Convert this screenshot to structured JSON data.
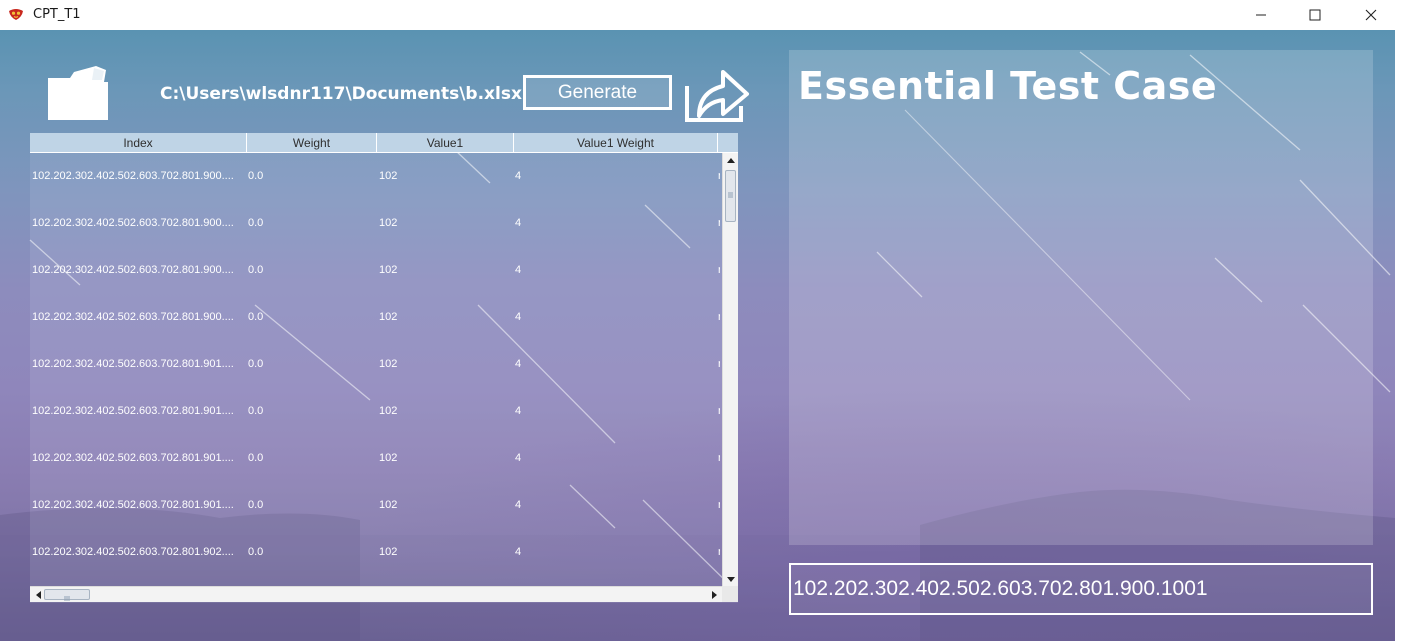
{
  "window": {
    "title": "CPT_T1"
  },
  "toolbar": {
    "file_path": "C:\\Users\\wlsdnr117\\Documents\\b.xlsx",
    "generate_label": "Generate"
  },
  "table": {
    "columns": [
      "Index",
      "Weight",
      "Value1",
      "Value1 Weight"
    ],
    "rows": [
      {
        "index": "102.202.302.402.502.603.702.801.900....",
        "weight": "0.0",
        "value1": "102",
        "value1_weight": "4",
        "overflow": "r"
      },
      {
        "index": "102.202.302.402.502.603.702.801.900....",
        "weight": "0.0",
        "value1": "102",
        "value1_weight": "4",
        "overflow": "r"
      },
      {
        "index": "102.202.302.402.502.603.702.801.900....",
        "weight": "0.0",
        "value1": "102",
        "value1_weight": "4",
        "overflow": "r"
      },
      {
        "index": "102.202.302.402.502.603.702.801.900....",
        "weight": "0.0",
        "value1": "102",
        "value1_weight": "4",
        "overflow": "r"
      },
      {
        "index": "102.202.302.402.502.603.702.801.901....",
        "weight": "0.0",
        "value1": "102",
        "value1_weight": "4",
        "overflow": "r"
      },
      {
        "index": "102.202.302.402.502.603.702.801.901....",
        "weight": "0.0",
        "value1": "102",
        "value1_weight": "4",
        "overflow": "r"
      },
      {
        "index": "102.202.302.402.502.603.702.801.901....",
        "weight": "0.0",
        "value1": "102",
        "value1_weight": "4",
        "overflow": "r"
      },
      {
        "index": "102.202.302.402.502.603.702.801.901....",
        "weight": "0.0",
        "value1": "102",
        "value1_weight": "4",
        "overflow": "r"
      },
      {
        "index": "102.202.302.402.502.603.702.801.902....",
        "weight": "0.0",
        "value1": "102",
        "value1_weight": "4",
        "overflow": "r"
      }
    ]
  },
  "essential": {
    "title": "Essential Test Case"
  },
  "result": {
    "value": "102.202.302.402.502.603.702.801.900.1001"
  },
  "icons": {
    "app": "app-logo-icon",
    "open": "folder-open-icon",
    "export": "export-share-icon"
  }
}
